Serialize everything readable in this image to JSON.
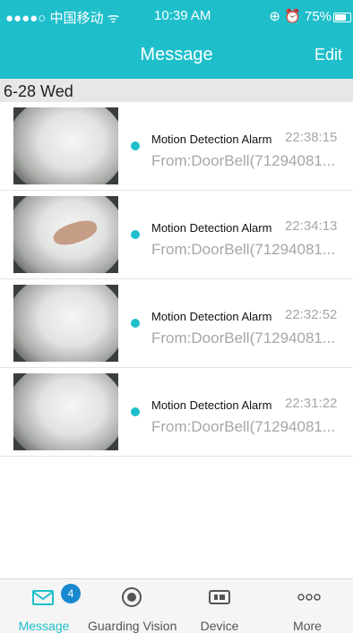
{
  "status_bar": {
    "carrier": "●●●●○ 中国移动 ᯤ",
    "time": "10:39 AM",
    "indicators": "⊕ ⏰ 75%"
  },
  "nav": {
    "title": "Message",
    "edit_label": "Edit"
  },
  "section": {
    "date": "6-28 Wed"
  },
  "messages": [
    {
      "title": "Motion Detection Alarm",
      "time": "22:38:15",
      "source": "From:DoorBell(71294081..."
    },
    {
      "title": "Motion Detection Alarm",
      "time": "22:34:13",
      "source": "From:DoorBell(71294081..."
    },
    {
      "title": "Motion Detection Alarm",
      "time": "22:32:52",
      "source": "From:DoorBell(71294081..."
    },
    {
      "title": "Motion Detection Alarm",
      "time": "22:31:22",
      "source": "From:DoorBell(71294081..."
    }
  ],
  "tabs": [
    {
      "label": "Message",
      "icon": "mail-icon",
      "badge": "4"
    },
    {
      "label": "Guarding Vision",
      "icon": "record-icon"
    },
    {
      "label": "Device",
      "icon": "device-icon"
    },
    {
      "label": "More",
      "icon": "more-icon"
    }
  ],
  "colors": {
    "accent": "#1ebfcb",
    "badge": "#1a88cf"
  }
}
